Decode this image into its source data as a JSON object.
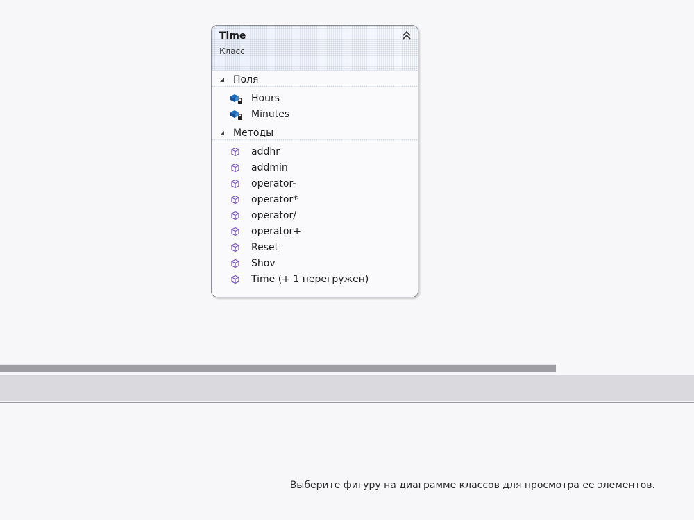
{
  "class_shape": {
    "title": "Time",
    "subtitle": "Класс",
    "collapse_icon": "double-chevron-up-icon",
    "sections": [
      {
        "label": "Поля",
        "member_icon": "field-lock-icon",
        "items": [
          "Hours",
          "Minutes"
        ]
      },
      {
        "label": "Методы",
        "member_icon": "method-cube-icon",
        "items": [
          "addhr",
          "addmin",
          "operator-",
          "operator*",
          "operator/",
          "operator+",
          "Reset",
          "Shov",
          "Time (+ 1 перегружен)"
        ]
      }
    ]
  },
  "colors": {
    "field_icon_blue": "#1e6fbf",
    "method_icon_purple": "#7a55b0"
  },
  "details": {
    "hint": "Выберите фигуру на диаграмме классов для просмотра ее элементов."
  }
}
